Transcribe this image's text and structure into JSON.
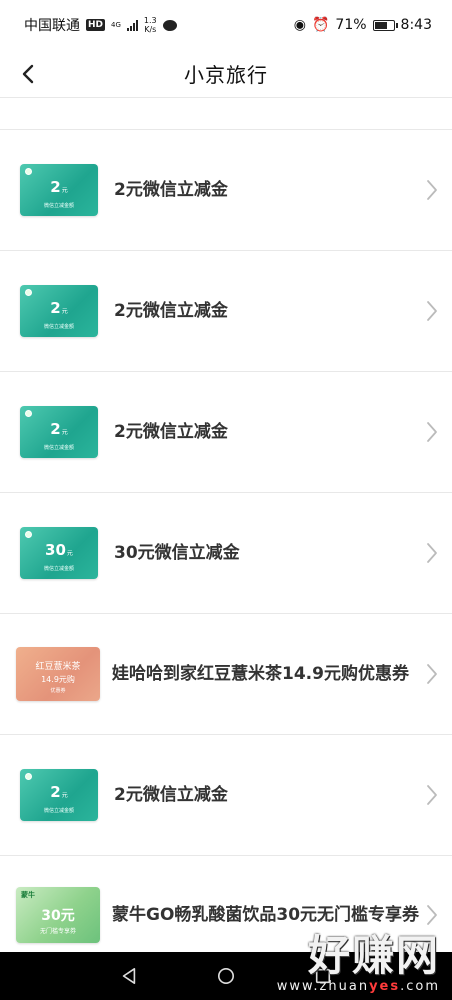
{
  "status_bar": {
    "carrier": "中国联通",
    "hd_badge": "HD",
    "network": "4G",
    "speed_value": "1.3",
    "speed_unit": "K/s",
    "battery": "71%",
    "time": "8:43",
    "battery_level": 0.71
  },
  "header": {
    "title": "小京旅行"
  },
  "items": [
    {
      "title": "2元微信立减金",
      "coupon": {
        "type": "green",
        "amount": "2",
        "unit": "元",
        "sub": "微信立减金额"
      }
    },
    {
      "title": "2元微信立减金",
      "coupon": {
        "type": "green",
        "amount": "2",
        "unit": "元",
        "sub": "微信立减金额"
      }
    },
    {
      "title": "2元微信立减金",
      "coupon": {
        "type": "green",
        "amount": "2",
        "unit": "元",
        "sub": "微信立减金额"
      }
    },
    {
      "title": "30元微信立减金",
      "coupon": {
        "type": "green",
        "amount": "30",
        "unit": "元",
        "sub": "微信立减金额"
      }
    },
    {
      "title": "娃哈哈到家红豆薏米茶14.9元购优惠券",
      "coupon": {
        "type": "orange",
        "line1": "红豆薏米茶",
        "line2": "14.9元购",
        "line3": "优惠券"
      }
    },
    {
      "title": "2元微信立减金",
      "coupon": {
        "type": "green",
        "amount": "2",
        "unit": "元",
        "sub": "微信立减金额"
      }
    },
    {
      "title": "蒙牛GO畅乳酸菌饮品30元无门槛专享券",
      "coupon": {
        "type": "mengniu",
        "brand": "蒙牛",
        "amount": "30元",
        "sub": "无门槛专享券"
      }
    }
  ],
  "watermark": {
    "title": "好赚网",
    "url_prefix": "www.zhuan",
    "url_highlight": "yes",
    "url_suffix": ".com"
  },
  "colors": {
    "coupon_green": "#1fa58f",
    "coupon_orange": "#e4937a",
    "coupon_mengniu": "#8fd28c",
    "divider": "#e8e8e8"
  }
}
